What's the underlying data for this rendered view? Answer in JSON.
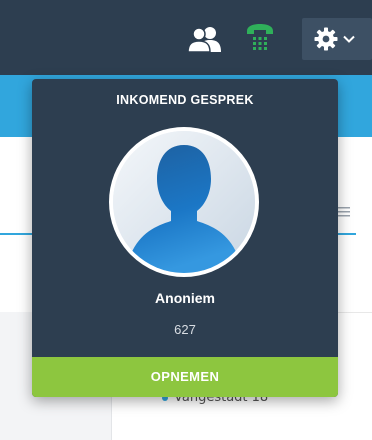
{
  "topbar": {
    "icons": [
      "contacts-icon",
      "phone-dialpad-icon",
      "gear-icon",
      "chevron-down-icon"
    ],
    "colors": {
      "background": "#2d3e50",
      "phone_icon": "#2fb05a"
    }
  },
  "incoming_call": {
    "title": "INKOMEND GESPREK",
    "caller_name": "Anoniem",
    "caller_number": "627",
    "answer_label": "OPNEMEN",
    "avatar_icon": "anonymous-user-silhouette-icon",
    "colors": {
      "panel": "#2d3e50",
      "answer_button": "#8dc63f"
    }
  },
  "background_page": {
    "accent": "#31a6dd",
    "partial_list_text": "Vangestadt 18"
  }
}
